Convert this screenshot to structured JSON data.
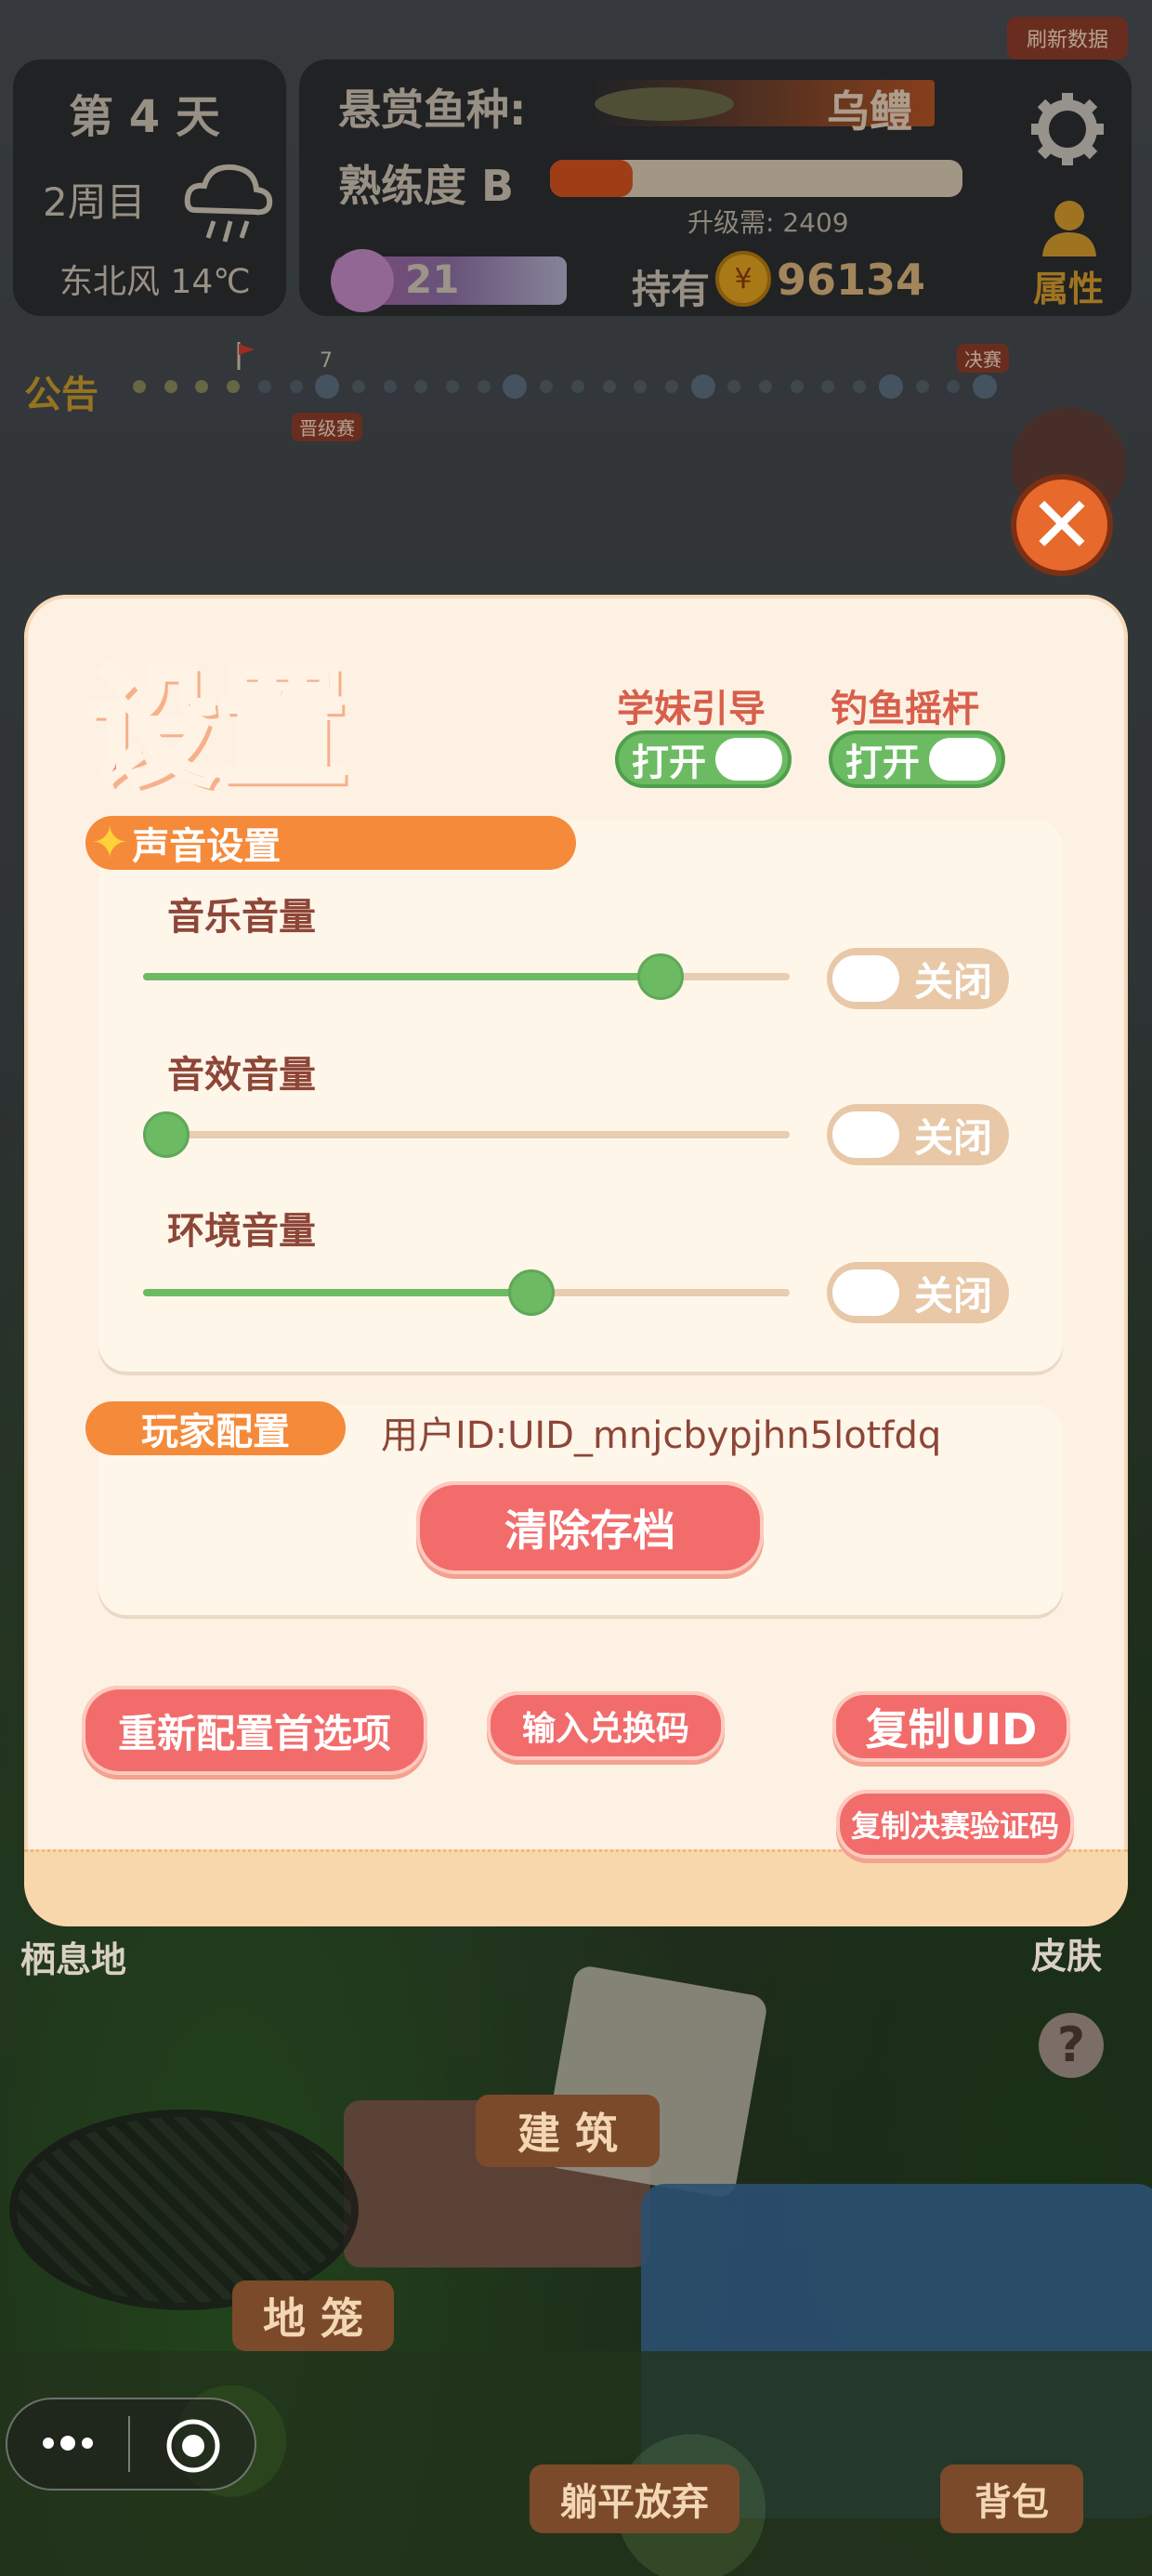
{
  "hud": {
    "refresh_label": "刷新数据",
    "day_label": "第 4 天",
    "week_label": "2周目",
    "weather_label": "东北风 14℃",
    "bounty_label": "悬赏鱼种:",
    "bounty_fish": "乌鳢",
    "skill_label": "熟练度 B",
    "skill_progress": 0.2,
    "upgrade_label": "升级需: 2409",
    "gem_count": "21",
    "owned_label": "持有",
    "coins": "96134",
    "attributes_label": "属性"
  },
  "timeline": {
    "announce_label": "公告",
    "marker_number": "7",
    "tag_rank": "晋级赛",
    "tag_final": "决赛"
  },
  "settings": {
    "title": "设置",
    "toggle_guide_label": "学妹引导",
    "toggle_guide_state": "打开",
    "toggle_joystick_label": "钓鱼摇杆",
    "toggle_joystick_state": "打开",
    "sound_section_label": "声音设置",
    "music_label": "音乐音量",
    "music_level": 0.8,
    "sfx_label": "音效音量",
    "sfx_level": 0.0,
    "ambient_label": "环境音量",
    "ambient_level": 0.6,
    "mute_state": "关闭",
    "player_section_label": "玩家配置",
    "user_id_text": "用户ID:UID_mnjcbypjhn5lotfdq",
    "clear_save_label": "清除存档",
    "reset_prefs_label": "重新配置首选项",
    "redeem_label": "输入兑换码",
    "copy_uid_label": "复制UID",
    "copy_final_code_label": "复制决赛验证码"
  },
  "scene": {
    "habitat_label": "栖息地",
    "skin_label": "皮肤",
    "build_label": "建 筑",
    "trap_label": "地 笼",
    "giveup_label": "躺平放弃",
    "backpack_label": "背包",
    "help_symbol": "?"
  },
  "colors": {
    "accent_green": "#6cbb63",
    "accent_pink": "#f26c6c",
    "accent_orange": "#f58a3a",
    "modal_bg": "#fdf1e3"
  }
}
